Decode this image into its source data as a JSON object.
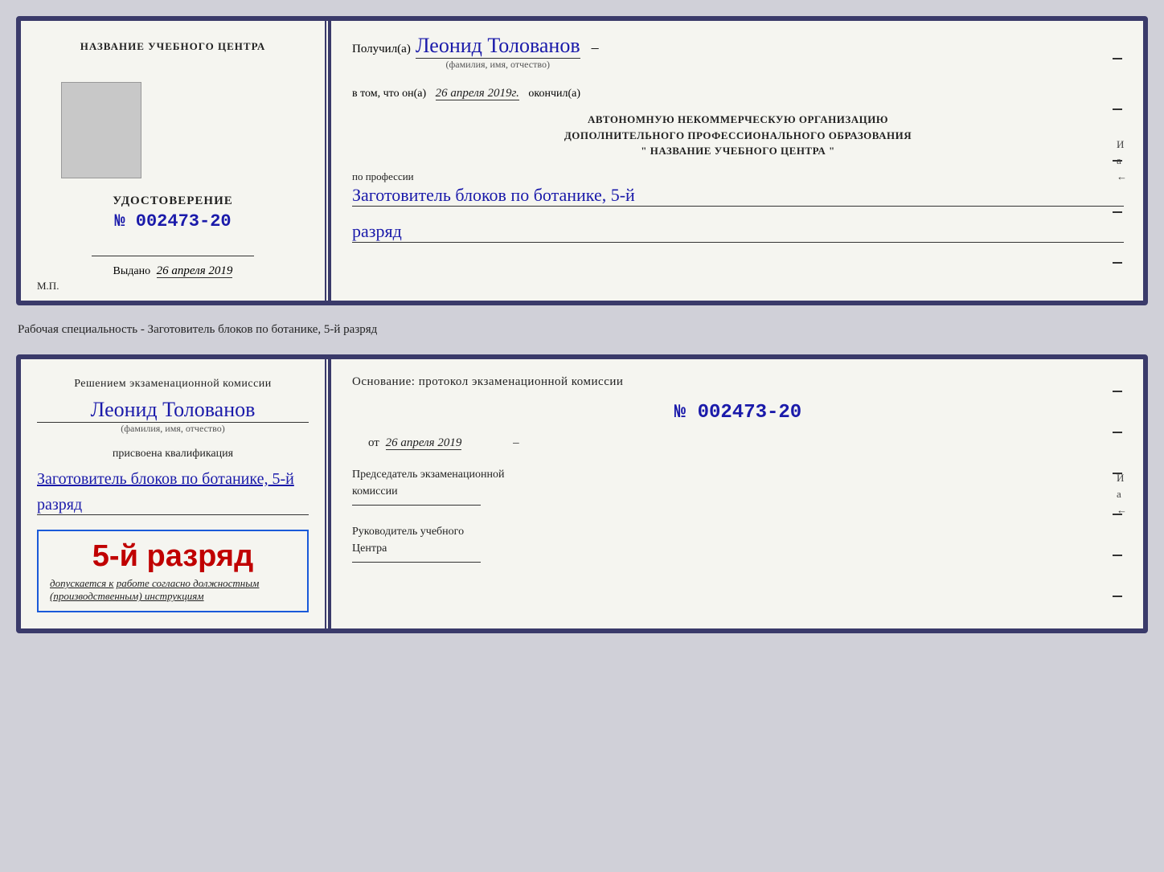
{
  "page": {
    "background": "#d0d0d8"
  },
  "cert1": {
    "left": {
      "title": "НАЗВАНИЕ УЧЕБНОГО ЦЕНТРА",
      "udost_label": "УДОСТОВЕРЕНИЕ",
      "number": "№ 002473-20",
      "issued_label": "Выдано",
      "issued_date": "26 апреля 2019",
      "mp": "М.П."
    },
    "right": {
      "received_label": "Получил(а)",
      "received_name": "Леонид Толованов",
      "received_subtitle": "(фамилия, имя, отчество)",
      "date_prefix": "в том, что он(а)",
      "date_value": "26 апреля 2019г.",
      "date_suffix": "окончил(а)",
      "org_line1": "АВТОНОМНУЮ НЕКОММЕРЧЕСКУЮ ОРГАНИЗАЦИЮ",
      "org_line2": "ДОПОЛНИТЕЛЬНОГО ПРОФЕССИОНАЛЬНОГО ОБРАЗОВАНИЯ",
      "org_line3": "\"  НАЗВАНИЕ УЧЕБНОГО ЦЕНТРА  \"",
      "profession_label": "по профессии",
      "profession_value": "Заготовитель блоков по ботанике, 5-й",
      "rank_value": "разряд",
      "side_chars": [
        "И",
        "а",
        "←"
      ]
    }
  },
  "specialty_text": "Рабочая специальность - Заготовитель блоков по ботанике, 5-й разряд",
  "cert2": {
    "left": {
      "decision_line1": "Решением экзаменационной комиссии",
      "person_name": "Леонид Толованов",
      "person_subtitle": "(фамилия, имя, отчество)",
      "assigned_label": "присвоена квалификация",
      "profession_value": "Заготовитель блоков по ботанике, 5-й",
      "rank_value": "разряд",
      "blue_box_grade": "5-й разряд",
      "admit_prefix": "допускается к",
      "admit_text": "работе согласно должностным",
      "admit_text2": "(производственным) инструкциям"
    },
    "right": {
      "basis_label": "Основание: протокол экзаменационной комиссии",
      "basis_number": "№ 002473-20",
      "date_prefix": "от",
      "date_value": "26 апреля 2019",
      "chairman_title": "Председатель экзаменационной",
      "chairman_title2": "комиссии",
      "director_title": "Руководитель учебного",
      "director_title2": "Центра",
      "side_chars": [
        "И",
        "а",
        "←"
      ]
    }
  }
}
